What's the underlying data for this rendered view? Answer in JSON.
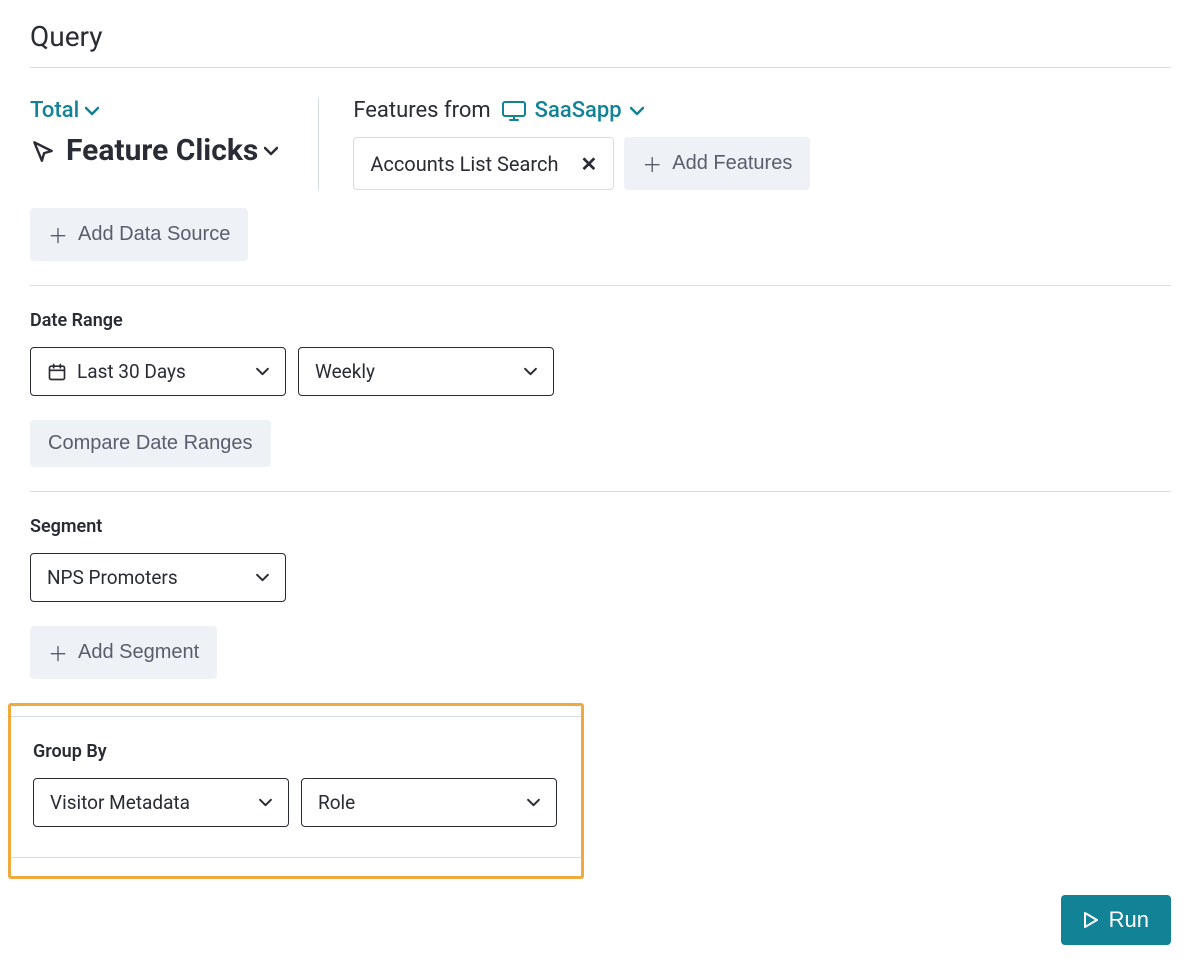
{
  "title": "Query",
  "total": {
    "label": "Total"
  },
  "metric": {
    "label": "Feature Clicks"
  },
  "features": {
    "from_label": "Features from",
    "app_name": "SaaSapp",
    "chips": [
      {
        "label": "Accounts List Search"
      }
    ],
    "add_label": "Add Features"
  },
  "add_data_source": "Add Data Source",
  "date_range": {
    "label": "Date Range",
    "range_value": "Last 30 Days",
    "granularity_value": "Weekly",
    "compare_label": "Compare Date Ranges"
  },
  "segment": {
    "label": "Segment",
    "value": "NPS Promoters",
    "add_label": "Add Segment"
  },
  "group_by": {
    "label": "Group By",
    "category_value": "Visitor Metadata",
    "field_value": "Role"
  },
  "run_label": "Run"
}
